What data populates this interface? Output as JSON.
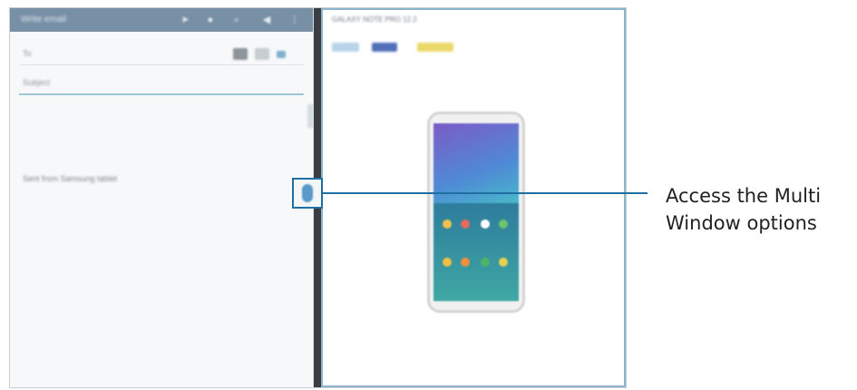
{
  "colors": {
    "appbar": "#7790a6",
    "divider": "#3a3e42",
    "callout_blue": "#1f6fa3",
    "handle": "#5a9ac8"
  },
  "email_pane": {
    "title": "Write email",
    "toolbar_icons": [
      "send-icon",
      "attach-icon",
      "search-icon",
      "mute-icon",
      "more-icon"
    ],
    "to_label": "To",
    "subject_label": "Subject",
    "signature": "Sent from Samsung tablet"
  },
  "divider_handle": {
    "icon": "multi-window-handle-icon"
  },
  "web_pane": {
    "heading": "GALAXY NOTE PRO 12.2",
    "subheading": "",
    "footer_lines": [
      "",
      ""
    ]
  },
  "callout": {
    "line1": "Access the Multi",
    "line2": "Window options"
  }
}
